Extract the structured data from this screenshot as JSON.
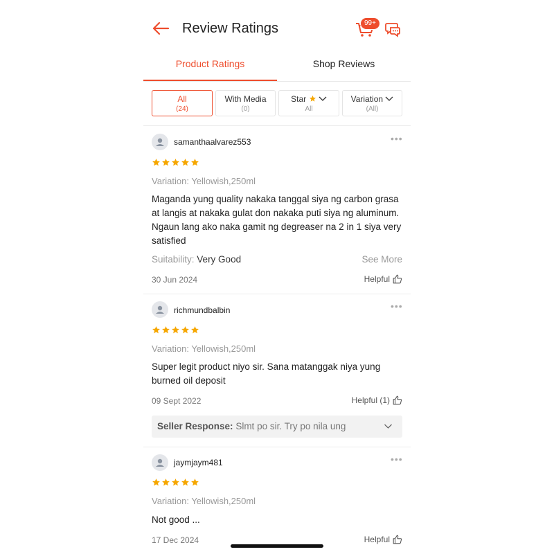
{
  "header": {
    "title": "Review Ratings",
    "cart_badge": "99+"
  },
  "tabs": [
    {
      "label": "Product Ratings"
    },
    {
      "label": "Shop Reviews"
    }
  ],
  "filters": [
    {
      "label": "All",
      "sub": "(24)"
    },
    {
      "label": "With Media",
      "sub": "(0)"
    },
    {
      "label": "Star",
      "sub": "All"
    },
    {
      "label": "Variation",
      "sub": "(All)"
    }
  ],
  "reviews": [
    {
      "user": "samanthaalvarez553",
      "rating": 5,
      "variation": "Variation: Yellowish,250ml",
      "body": "Maganda yung quality nakaka tanggal siya ng carbon grasa at langis at nakaka gulat don nakaka puti siya ng aluminum. Ngaun lang ako naka gamit ng degreaser na 2 in 1 siya very satisfied",
      "suitability_label": "Suitability:",
      "suitability_value": "Very Good",
      "see_more": "See More",
      "date": "30 Jun 2024",
      "helpful": "Helpful"
    },
    {
      "user": "richmundbalbin",
      "rating": 5,
      "variation": "Variation: Yellowish,250ml",
      "body": "Super legit product niyo sir. Sana matanggak niya yung burned oil deposit",
      "date": "09 Sept 2022",
      "helpful": "Helpful (1)",
      "seller_label": "Seller Response:",
      "seller_text": "Slmt po sir. Try po nila ung"
    },
    {
      "user": "jaymjaym481",
      "rating": 5,
      "variation": "Variation: Yellowish,250ml",
      "body": "Not good ...",
      "date": "17 Dec 2024",
      "helpful": "Helpful"
    }
  ],
  "colors": {
    "accent": "#ee4d2d",
    "star": "#f6a700"
  }
}
